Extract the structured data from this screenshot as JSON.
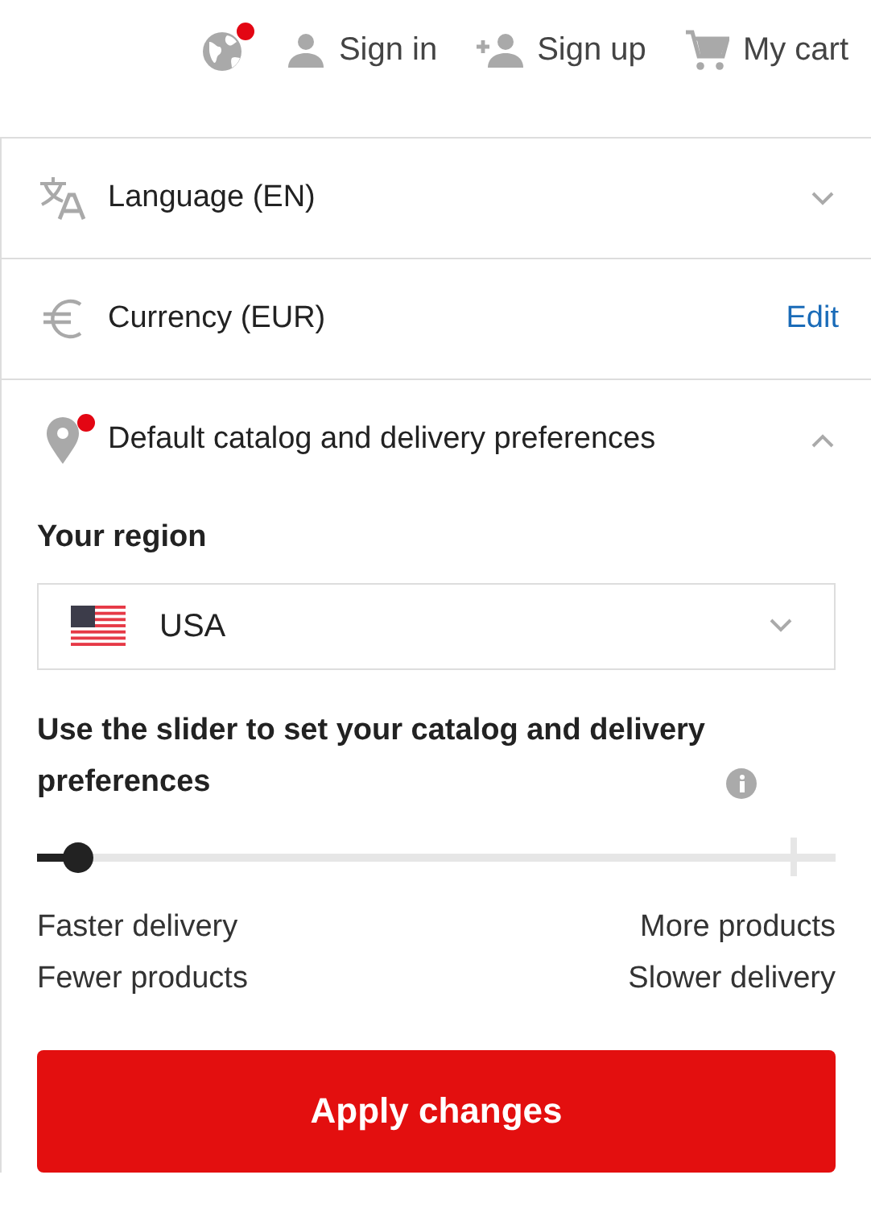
{
  "header": {
    "nav": [
      {
        "kind": "globe",
        "notification": true
      },
      {
        "kind": "user",
        "label": "Sign in"
      },
      {
        "kind": "add-user",
        "label": "Sign up"
      },
      {
        "kind": "cart",
        "label": "My cart"
      }
    ]
  },
  "sections": [
    {
      "kind": "dropdown",
      "label": "Language (EN)",
      "expanded": false
    },
    {
      "kind": "edit",
      "label": "Currency (EUR)",
      "action": "Edit"
    },
    {
      "kind": "dropdown",
      "label": "Default catalog and delivery preferences",
      "expanded": true,
      "notification": true
    }
  ],
  "region": {
    "label": "Your region",
    "value": "USA"
  },
  "slider": {
    "label": "Use the slider to set your catalog and delivery preferences",
    "level": 0.05,
    "left": [
      "Faster delivery",
      "Fewer products"
    ],
    "right": [
      "More products",
      "Slower delivery"
    ]
  },
  "apply_button": "Apply changes"
}
